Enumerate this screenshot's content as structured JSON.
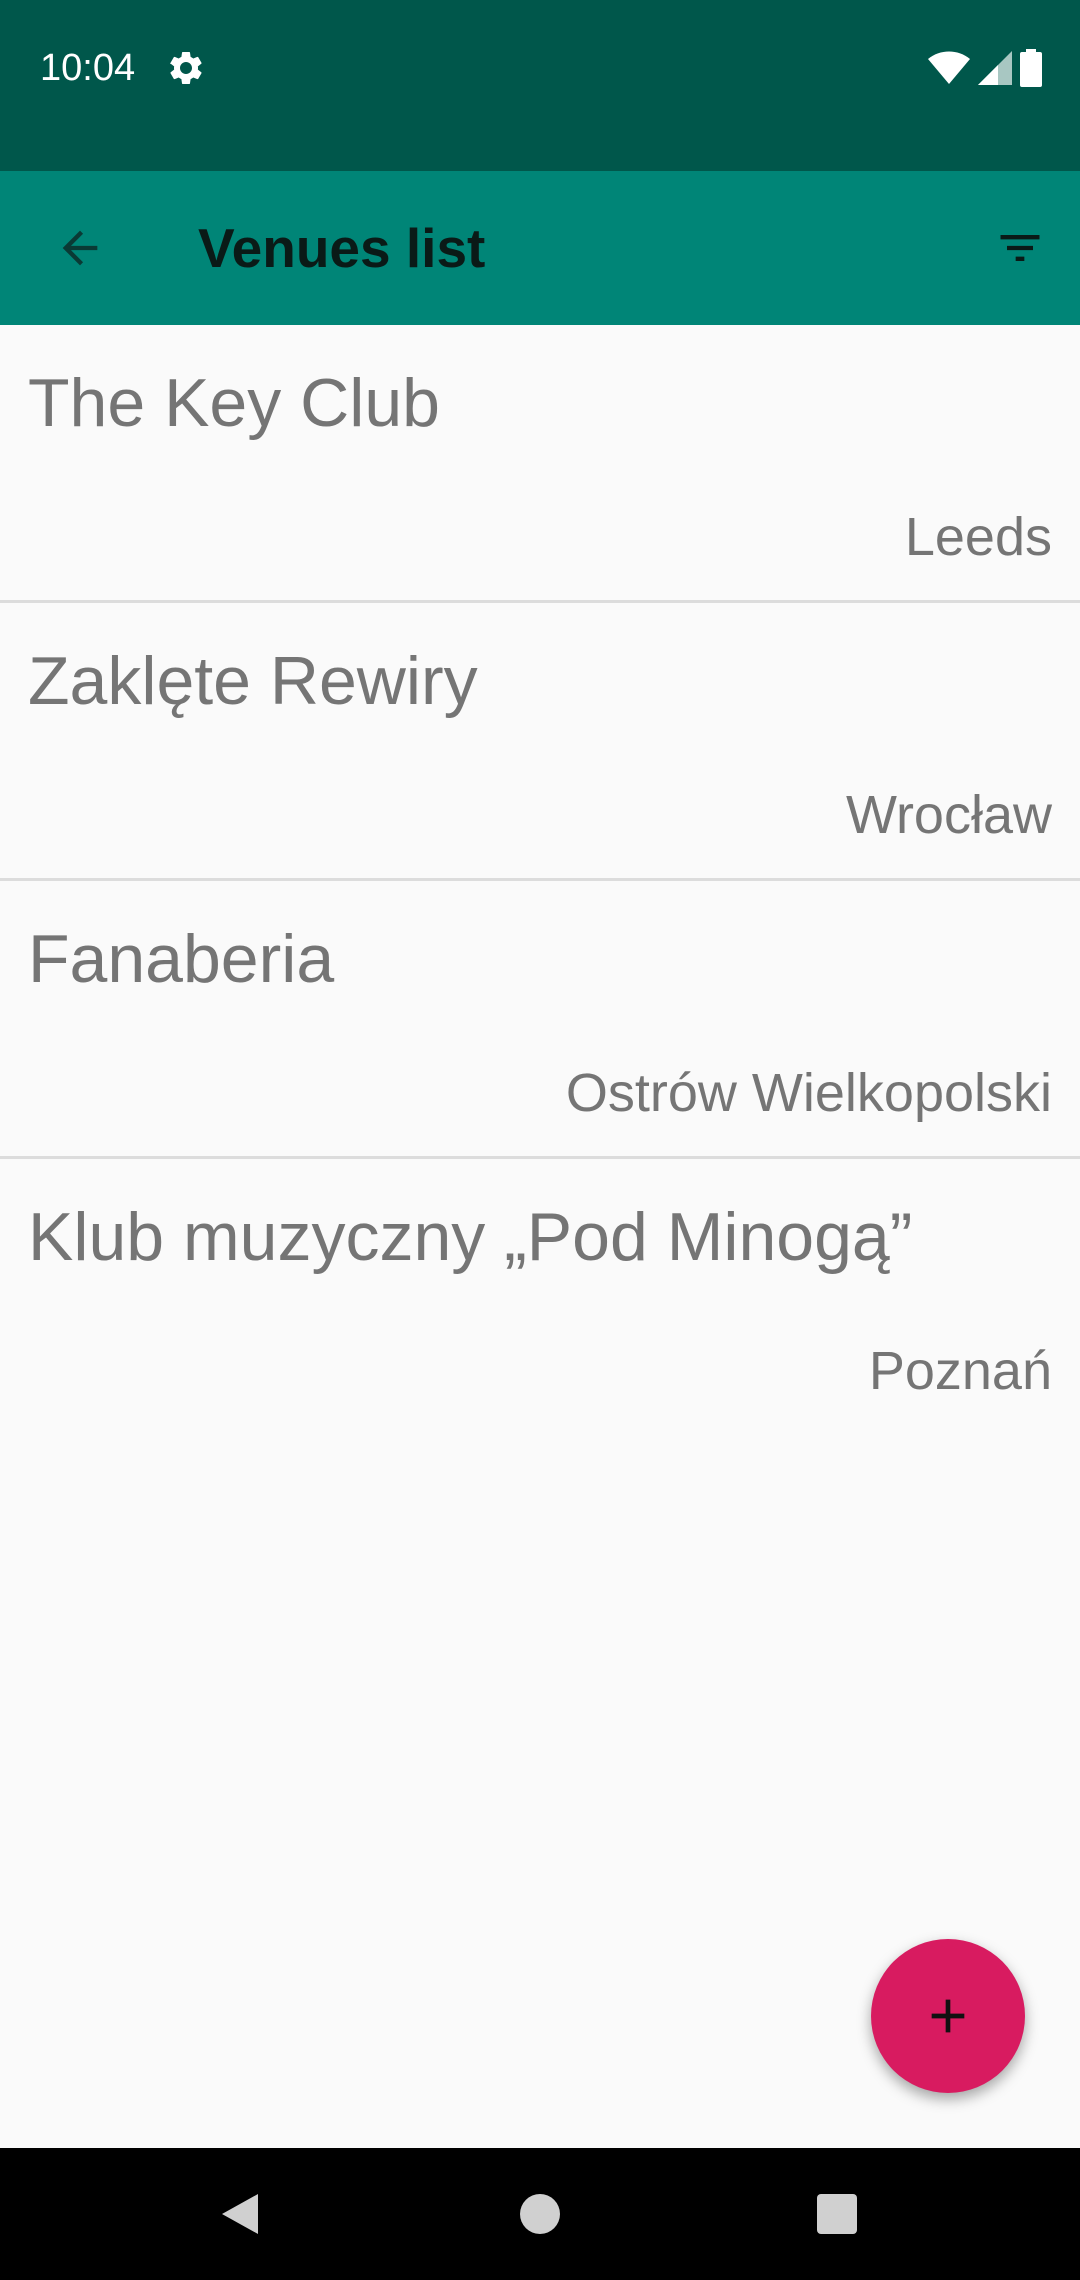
{
  "status_bar": {
    "time": "10:04",
    "icons": [
      "settings-icon",
      "wifi-icon",
      "cell-signal-icon",
      "battery-icon"
    ],
    "background": "#00574b"
  },
  "app_bar": {
    "title": "Venues list",
    "back_icon": "arrow-back-icon",
    "filter_icon": "filter-icon",
    "background": "#008577"
  },
  "venues": [
    {
      "name": "The Key Club",
      "city": "Leeds"
    },
    {
      "name": "Zaklęte Rewiry",
      "city": "Wrocław"
    },
    {
      "name": "Fanaberia",
      "city": "Ostrów Wielkopolski"
    },
    {
      "name": "Klub muzyczny „Pod Minogą”",
      "city": "Poznań"
    }
  ],
  "fab": {
    "icon": "add-icon",
    "color": "#d81b60"
  },
  "nav_bar": {
    "icons": [
      "nav-back-icon",
      "nav-home-icon",
      "nav-recents-icon"
    ]
  }
}
